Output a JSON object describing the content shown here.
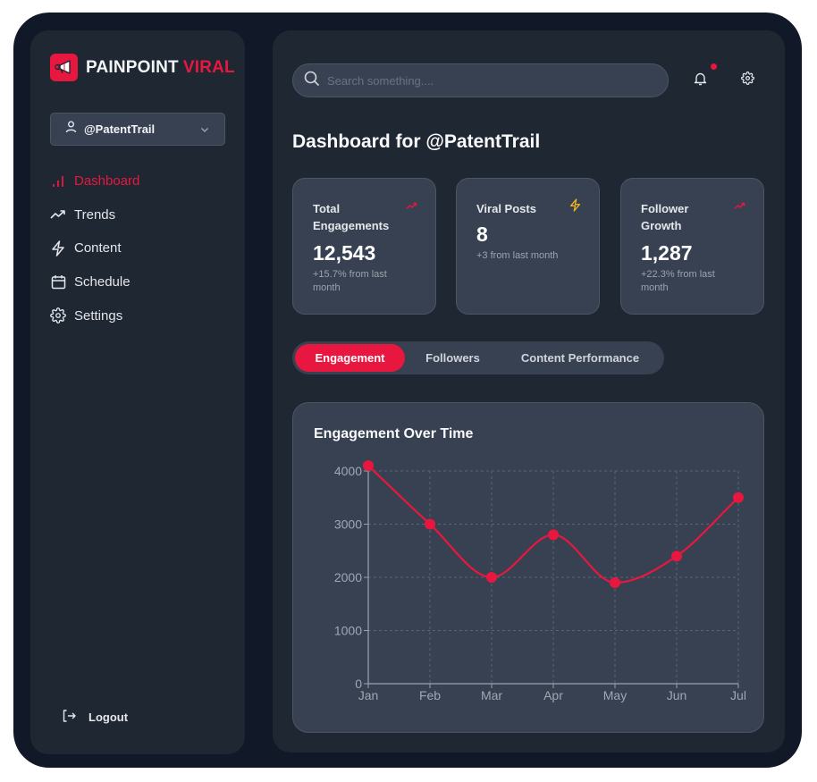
{
  "brand": {
    "name_primary": "PAINPOINT",
    "name_accent": "VIRAL",
    "accent_color": "#e8173f"
  },
  "account": {
    "handle": "@PatentTrail"
  },
  "sidebar": {
    "items": [
      {
        "label": "Dashboard",
        "icon": "bar-chart-icon",
        "active": true
      },
      {
        "label": "Trends",
        "icon": "trending-up-icon",
        "active": false
      },
      {
        "label": "Content",
        "icon": "lightning-icon",
        "active": false
      },
      {
        "label": "Schedule",
        "icon": "calendar-icon",
        "active": false
      },
      {
        "label": "Settings",
        "icon": "gear-icon",
        "active": false
      }
    ],
    "logout_label": "Logout"
  },
  "header": {
    "search_placeholder": "Search something....",
    "has_notification": true
  },
  "page_title": "Dashboard for @PatentTrail",
  "stats": [
    {
      "title": "Total Engagements",
      "value": "12,543",
      "subtitle": "+15.7% from last month",
      "icon": "trending-up-icon"
    },
    {
      "title": "Viral Posts",
      "value": "8",
      "subtitle": "+3 from last month",
      "icon": "lightning-icon"
    },
    {
      "title": "Follower Growth",
      "value": "1,287",
      "subtitle": "+22.3% from last month",
      "icon": "trending-up-icon"
    }
  ],
  "tabs": [
    {
      "label": "Engagement",
      "active": true
    },
    {
      "label": "Followers",
      "active": false
    },
    {
      "label": "Content Performance",
      "active": false
    }
  ],
  "chart_data": {
    "type": "line",
    "title": "Engagement Over Time",
    "categories": [
      "Jan",
      "Feb",
      "Mar",
      "Apr",
      "May",
      "Jun",
      "Jul"
    ],
    "series": [
      {
        "name": "Engagement",
        "values": [
          4100,
          3000,
          2000,
          2800,
          1900,
          2400,
          3500
        ],
        "color": "#e8173f"
      }
    ],
    "yticks": [
      0,
      1000,
      2000,
      3000,
      4000
    ],
    "ylim": [
      0,
      4000
    ],
    "xlabel": "",
    "ylabel": "",
    "grid": true,
    "legend": "none"
  }
}
